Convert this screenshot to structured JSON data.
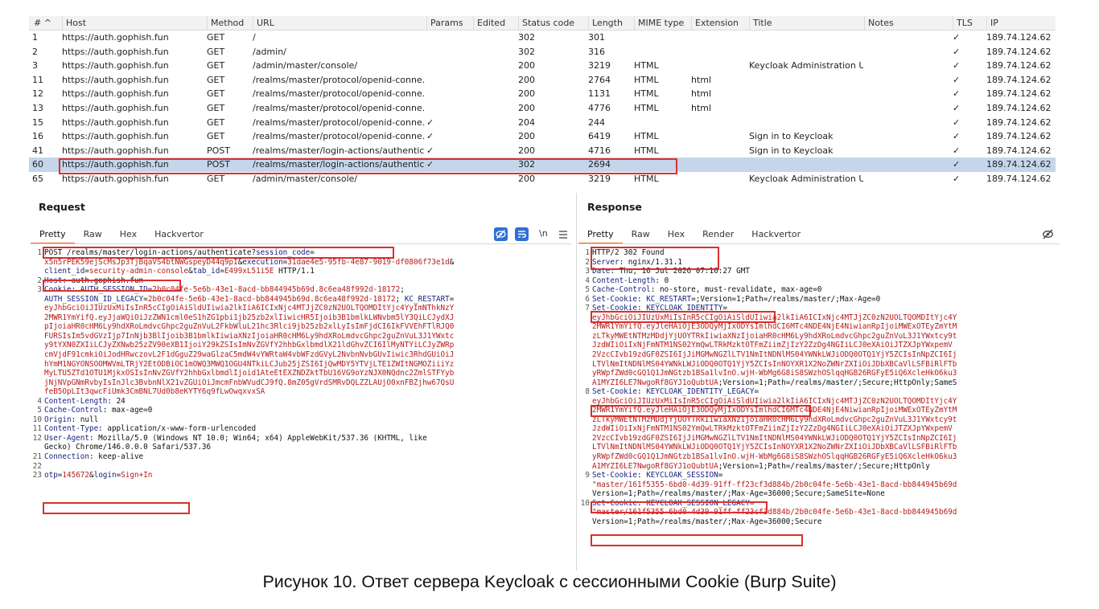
{
  "history": {
    "columns": [
      "# ^",
      "Host",
      "Method",
      "URL",
      "Params",
      "Edited",
      "Status code",
      "Length",
      "MIME type",
      "Extension",
      "Title",
      "Notes",
      "TLS",
      "IP"
    ],
    "rows": [
      {
        "num": "1",
        "host": "https://auth.gophish.fun",
        "method": "GET",
        "url": "/",
        "params": "",
        "status": "302",
        "length": "301",
        "mime": "",
        "ext": "",
        "title": "",
        "tls": "✓",
        "ip": "189.74.124.62"
      },
      {
        "num": "2",
        "host": "https://auth.gophish.fun",
        "method": "GET",
        "url": "/admin/",
        "params": "",
        "status": "302",
        "length": "316",
        "mime": "",
        "ext": "",
        "title": "",
        "tls": "✓",
        "ip": "189.74.124.62"
      },
      {
        "num": "3",
        "host": "https://auth.gophish.fun",
        "method": "GET",
        "url": "/admin/master/console/",
        "params": "",
        "status": "200",
        "length": "3219",
        "mime": "HTML",
        "ext": "",
        "title": "Keycloak Administration UI",
        "tls": "✓",
        "ip": "189.74.124.62"
      },
      {
        "num": "11",
        "host": "https://auth.gophish.fun",
        "method": "GET",
        "url": "/realms/master/protocol/openid-conne...",
        "params": "",
        "status": "200",
        "length": "2764",
        "mime": "HTML",
        "ext": "html",
        "title": "",
        "tls": "✓",
        "ip": "189.74.124.62"
      },
      {
        "num": "12",
        "host": "https://auth.gophish.fun",
        "method": "GET",
        "url": "/realms/master/protocol/openid-conne...",
        "params": "",
        "status": "200",
        "length": "1131",
        "mime": "HTML",
        "ext": "html",
        "title": "",
        "tls": "✓",
        "ip": "189.74.124.62"
      },
      {
        "num": "13",
        "host": "https://auth.gophish.fun",
        "method": "GET",
        "url": "/realms/master/protocol/openid-conne...",
        "params": "",
        "status": "200",
        "length": "4776",
        "mime": "HTML",
        "ext": "html",
        "title": "",
        "tls": "✓",
        "ip": "189.74.124.62"
      },
      {
        "num": "15",
        "host": "https://auth.gophish.fun",
        "method": "GET",
        "url": "/realms/master/protocol/openid-conne...",
        "params": "✓",
        "status": "204",
        "length": "244",
        "mime": "",
        "ext": "",
        "title": "",
        "tls": "✓",
        "ip": "189.74.124.62"
      },
      {
        "num": "16",
        "host": "https://auth.gophish.fun",
        "method": "GET",
        "url": "/realms/master/protocol/openid-conne...",
        "params": "✓",
        "status": "200",
        "length": "6419",
        "mime": "HTML",
        "ext": "",
        "title": "Sign in to Keycloak",
        "tls": "✓",
        "ip": "189.74.124.62"
      },
      {
        "num": "41",
        "host": "https://auth.gophish.fun",
        "method": "POST",
        "url": "/realms/master/login-actions/authentic...",
        "params": "✓",
        "status": "200",
        "length": "4716",
        "mime": "HTML",
        "ext": "",
        "title": "Sign in to Keycloak",
        "tls": "✓",
        "ip": "189.74.124.62"
      },
      {
        "num": "60",
        "host": "https://auth.gophish.fun",
        "method": "POST",
        "url": "/realms/master/login-actions/authentic...",
        "params": "✓",
        "status": "302",
        "length": "2694",
        "mime": "",
        "ext": "",
        "title": "",
        "tls": "✓",
        "ip": "189.74.124.62"
      },
      {
        "num": "65",
        "host": "https://auth.gophish.fun",
        "method": "GET",
        "url": "/admin/master/console/",
        "params": "",
        "status": "200",
        "length": "3219",
        "mime": "HTML",
        "ext": "",
        "title": "Keycloak Administration UI",
        "tls": "✓",
        "ip": "189.74.124.62"
      }
    ]
  },
  "request": {
    "title": "Request",
    "tabs": [
      "Pretty",
      "Raw",
      "Hex",
      "Hackvertor"
    ],
    "newline_toggle": "\\n",
    "lines": [
      {
        "n": "1",
        "segs": [
          [
            "POST /realms/master/login-actions/authenticate?",
            "t"
          ],
          [
            "session_code",
            "k"
          ],
          [
            "=",
            "t"
          ]
        ]
      },
      {
        "n": "",
        "segs": [
          [
            "x5n5rPEK59ejScMsJp3TjBqaVS4btNWGspeyD44q9pI",
            "v"
          ],
          [
            "&",
            "t"
          ],
          [
            "execution",
            "k"
          ],
          [
            "=",
            "t"
          ],
          [
            "31dae4e5-95fb-4e87-9019-df0806f73e1d",
            "v"
          ],
          [
            "&",
            "t"
          ]
        ]
      },
      {
        "n": "",
        "segs": [
          [
            "client_id",
            "k"
          ],
          [
            "=",
            "t"
          ],
          [
            "security-admin-console",
            "v"
          ],
          [
            "&",
            "t"
          ],
          [
            "tab_id",
            "k"
          ],
          [
            "=",
            "t"
          ],
          [
            "E499xL51i5E",
            "v"
          ],
          [
            " HTTP/1.1",
            "t"
          ]
        ]
      },
      {
        "n": "2",
        "segs": [
          [
            "Host",
            "k"
          ],
          [
            ": auth.gophish.fun",
            "t"
          ]
        ]
      },
      {
        "n": "3",
        "segs": [
          [
            "Cookie",
            "k"
          ],
          [
            ": ",
            "t"
          ],
          [
            "AUTH_SESSION_ID",
            "k"
          ],
          [
            "=",
            "t"
          ],
          [
            "2b0c04fe-5e6b-43e1-8acd-bb844945b69d.8c6ea48f992d-18172",
            "v"
          ],
          [
            ";",
            "t"
          ]
        ]
      },
      {
        "n": "",
        "segs": [
          [
            "AUTH_SESSION_ID_LEGACY",
            "k"
          ],
          [
            "=",
            "t"
          ],
          [
            "2b0c04fe-5e6b-43e1-8acd-bb844945b69d.8c6ea48f992d-18172",
            "v"
          ],
          [
            "; ",
            "t"
          ],
          [
            "KC_RESTART",
            "k"
          ],
          [
            "=",
            "t"
          ]
        ]
      },
      {
        "n": "",
        "segs": [
          [
            "eyJhbGciOiJIUzUxMiIsInR5cCIgOiAiSldUIiwia2lkIiA6ICIxNjc4MTJjZC0zN2UOLTQOMDItYjc4YyImNThkNzY",
            "v"
          ]
        ]
      },
      {
        "n": "",
        "segs": [
          [
            "2MWR1YmYifQ.eyJjaWQiOiJzZWN1cml0eS1hZG1pbi1jb25zb2xlIiwicHR5Ijoib3B1bmlkLWNvbm5lY3QiLCJydXJ",
            "v"
          ]
        ]
      },
      {
        "n": "",
        "segs": [
          [
            "pIjoiaHR0cHM6Ly9hdXRoLmdvcGhpc2guZnVuL2FkbWluL21hc3Rlci9jb25zb2xlLyIsImFjdCI6IkFVVEhFTlRJQ0",
            "v"
          ]
        ]
      },
      {
        "n": "",
        "segs": [
          [
            "FURSIsIm5vdGVzIjp7InNjb3BlIjoib3B1bmlkIiwiaXNzIjoiaHR0cHM6Ly9hdXRoLmdvcGhpc2guZnVuL3J1YWxtc",
            "v"
          ]
        ]
      },
      {
        "n": "",
        "segs": [
          [
            "y9tYXN0ZXIiLCJyZXNwb25zZV90eXB1IjoiY29kZSIsImNvZGVfY2hhbGxlbmdlX21ldGhvZCI6IlMyNTYiLCJyZWRp",
            "v"
          ]
        ]
      },
      {
        "n": "",
        "segs": [
          [
            "cmVjdF91cmkiOiJodHRwczovL2F1dGguZ29waGlzaC5mdW4vYWRtaW4vbWFzdGVyL2NvbnNvbGUvIiwic3RhdGUiOiJ",
            "v"
          ]
        ]
      },
      {
        "n": "",
        "segs": [
          [
            "hYmM1NGYONSOOMWVmLTRjY2EtODBiOC1mOWQ3MWQ1OGU4NTkiLCJub25jZSI6IjQwMDY5YTVjLTE1ZWItNGMOZiiiYz",
            "v"
          ]
        ]
      },
      {
        "n": "",
        "segs": [
          [
            "MyLTU5ZTd1OTU1MjkxOSIsInNvZGVfY2hhbGxlbmdlIjoid1AteEtEXZNDZktTbU16VG9oYzNJX0NQdnc2ZmlSTFYyb",
            "v"
          ]
        ]
      },
      {
        "n": "",
        "segs": [
          [
            "jNjNVpGNmRvbyIsInJlc3BvbnNlX21vZGUiOiJmcmFnbWVudCJ9fQ.8mZ05gVrdSMRvDQLZZLAUjO0xnFBZjhw67QsU",
            "v"
          ]
        ]
      },
      {
        "n": "",
        "segs": [
          [
            "feB5OpLIt3qwcFiUmk3CmBNL7Ud0b8eKYTY6q9fLwOwqxvxSA",
            "v"
          ]
        ]
      },
      {
        "n": "4",
        "segs": [
          [
            "Content-Length",
            "k"
          ],
          [
            ": 24",
            "t"
          ]
        ]
      },
      {
        "n": "5",
        "segs": [
          [
            "Cache-Control",
            "k"
          ],
          [
            ": max-age=0",
            "t"
          ]
        ]
      },
      {
        "n": "10",
        "segs": [
          [
            "Origin",
            "k"
          ],
          [
            ": null",
            "t"
          ]
        ]
      },
      {
        "n": "11",
        "segs": [
          [
            "Content-Type",
            "k"
          ],
          [
            ": application/x-www-form-urlencoded",
            "t"
          ]
        ]
      },
      {
        "n": "12",
        "segs": [
          [
            "User-Agent",
            "k"
          ],
          [
            ": Mozilla/5.0 (Windows NT 10.0; Win64; x64) AppleWebKit/537.36 (KHTML, like",
            "t"
          ]
        ]
      },
      {
        "n": "",
        "segs": [
          [
            "Gecko) Chrome/146.0.0.0 Safari/537.36",
            "t"
          ]
        ]
      },
      {
        "n": "21",
        "segs": [
          [
            "Connection",
            "k"
          ],
          [
            ": keep-alive",
            "t"
          ]
        ]
      },
      {
        "n": "22",
        "segs": []
      },
      {
        "n": "23",
        "segs": [
          [
            "otp",
            "k"
          ],
          [
            "=",
            "t"
          ],
          [
            "145672",
            "v"
          ],
          [
            "&",
            "t"
          ],
          [
            "login",
            "k"
          ],
          [
            "=",
            "t"
          ],
          [
            "Sign+In",
            "v"
          ]
        ]
      }
    ]
  },
  "response": {
    "title": "Response",
    "tabs": [
      "Pretty",
      "Raw",
      "Hex",
      "Render",
      "Hackvertor"
    ],
    "lines": [
      {
        "n": "1",
        "segs": [
          [
            "HTTP/2 302 Found",
            "t"
          ]
        ]
      },
      {
        "n": "2",
        "segs": [
          [
            "Server",
            "k"
          ],
          [
            ": nginx/1.31.1",
            "t"
          ]
        ]
      },
      {
        "n": "3",
        "segs": [
          [
            "Date",
            "k"
          ],
          [
            ": Thu, 16 Jul 2026 07:16:27 GMT",
            "t"
          ]
        ]
      },
      {
        "n": "4",
        "segs": [
          [
            "Content-Length",
            "k"
          ],
          [
            ": 0",
            "t"
          ]
        ]
      },
      {
        "n": "5",
        "segs": [
          [
            "Cache-Control",
            "k"
          ],
          [
            ": no-store, must-revalidate, max-age=0",
            "t"
          ]
        ]
      },
      {
        "n": "6",
        "segs": [
          [
            "Set-Cookie",
            "k"
          ],
          [
            ": ",
            "t"
          ],
          [
            "KC_RESTART",
            "k"
          ],
          [
            "=;Version=1;Path=/realms/master/;Max-Age=0",
            "t"
          ]
        ]
      },
      {
        "n": "7",
        "segs": [
          [
            "Set-Cookie",
            "k"
          ],
          [
            ": ",
            "t"
          ],
          [
            "KEYCLOAK_IDENTITY",
            "k"
          ],
          [
            "=",
            "t"
          ]
        ]
      },
      {
        "n": "",
        "segs": [
          [
            "eyJhbGciOiJIUzUxMiIsInR5cCIgOiAiSldUIiwia2lkIiA6ICIxNjc4MTJjZC0zN2UOLTQOMDItYjc4Y",
            "v"
          ]
        ]
      },
      {
        "n": "",
        "segs": [
          [
            "2MWR1YmYifQ.eyJleHAiOjE3ODQyMjIxODYsImlhdCI6MTc4NDE4NjE4NiwianRpIjoiMWExOTEyZmYtM",
            "v"
          ]
        ]
      },
      {
        "n": "",
        "segs": [
          [
            "zLTkyMWEtNTMzMDdjYjUOYTRkIiwiaXNzIjoiaHR0cHM6Ly9hdXRoLmdvcGhpc2guZnVuL3J1YWxtcy9t",
            "v"
          ]
        ]
      },
      {
        "n": "",
        "segs": [
          [
            "JzdWIiOiIxNjFmNTM1NS02YmQwLTRkMzktOTFmZiimZjIzY2ZzDg4NGIiLCJ0eXAiOiJTZXJpYWxpemV",
            "v"
          ]
        ]
      },
      {
        "n": "",
        "segs": [
          [
            "2VzcCIvb19zdGF0ZSI6IjJiMGMwNGZlLTV1NmItNDNlMS04YWNkLWJiODQ0OTQ1YjY5ZCIsInNpZCI6Ij",
            "v"
          ]
        ]
      },
      {
        "n": "",
        "segs": [
          [
            "LTVlNmItNDNlMS04YWNkLWJiODQ0OTQ1YjY5ZCIsInNOYXR1X2NoZWNrZXIiOiJDbXBCaVlLSFBiRlFTb",
            "v"
          ]
        ]
      },
      {
        "n": "",
        "segs": [
          [
            "yRWpfZWd0cGQ1Q1JmNGtzb1BSa1lvInO.wjH-WbMg6G8iS8SWzhOSlqqHGB26RGFyE5iQ6XcleHkO6ku3",
            "v"
          ]
        ]
      },
      {
        "n": "",
        "segs": [
          [
            "A1MYZI6LE7NwgoRf8GYJ1oQubtUA",
            "v"
          ],
          [
            ";Version=1;Path=/realms/master/;Secure;HttpOnly;SameS",
            "t"
          ]
        ]
      },
      {
        "n": "8",
        "segs": [
          [
            "Set-Cookie",
            "k"
          ],
          [
            ": ",
            "t"
          ],
          [
            "KEYCLOAK_IDENTITY_LEGACY",
            "k"
          ],
          [
            "=",
            "t"
          ]
        ]
      },
      {
        "n": "",
        "segs": [
          [
            "eyJhbGciOiJIUzUxMiIsInR5cCIgOiAiSldUIiwia2lkIiA6ICIxNjc4MTJjZC0zN2UOLTQOMDItYjc4Y",
            "v"
          ]
        ]
      },
      {
        "n": "",
        "segs": [
          [
            "2MWR1YmYifQ.eyJleHAiOjE3ODQyMjIxODYsImlhdCI6MTc4NDE4NjE4NiwianRpIjoiMWExOTEyZmYtM",
            "v"
          ]
        ]
      },
      {
        "n": "",
        "segs": [
          [
            "zLTkyMWEtNTMzMDdjYjUOYTRkIiwiaXNzIjoiaHR0cHM6Ly9hdXRoLmdvcGhpc2guZnVuL3J1YWxtcy9t",
            "v"
          ]
        ]
      },
      {
        "n": "",
        "segs": [
          [
            "JzdWIiOiIxNjFmNTM1NS02YmQwLTRkMzktOTFmZiimZjIzY2ZzDg4NGIiLCJ0eXAiOiJTZXJpYWxpemV",
            "v"
          ]
        ]
      },
      {
        "n": "",
        "segs": [
          [
            "2VzcCIvb19zdGF0ZSI6IjJiMGMwNGZlLTV1NmItNDNlMS04YWNkLWJiODQ0OTQ1YjY5ZCIsInNpZCI6Ij",
            "v"
          ]
        ]
      },
      {
        "n": "",
        "segs": [
          [
            "LTVlNmItNDNlMS04YWNkLWJiODQ0OTQ1YjY5ZCIsInNOYXR1X2NoZWNrZXIiOiJDbXBCaVlLSFBiRlFTb",
            "v"
          ]
        ]
      },
      {
        "n": "",
        "segs": [
          [
            "yRWpfZWd0cGQ1Q1JmNGtzb1BSa1lvInO.wjH-WbMg6G8iS8SWzhOSlqqHGB26RGFyE5iQ6XcleHkO6ku3",
            "v"
          ]
        ]
      },
      {
        "n": "",
        "segs": [
          [
            "A1MYZI6LE7NwgoRf8GYJ1oQubtUA",
            "v"
          ],
          [
            ";Version=1;Path=/realms/master/;Secure;HttpOnly",
            "t"
          ]
        ]
      },
      {
        "n": "9",
        "segs": [
          [
            "Set-Cookie",
            "k"
          ],
          [
            ": ",
            "t"
          ],
          [
            "KEYCLOAK_SESSION",
            "k"
          ],
          [
            "=",
            "t"
          ]
        ]
      },
      {
        "n": "",
        "segs": [
          [
            "\"master/161f5355-6bd0-4d39-91ff-ff23cf3d884b/2b0c04fe-5e6b-43e1-8acd-bb844945b69d",
            "v"
          ]
        ]
      },
      {
        "n": "",
        "segs": [
          [
            "Version=1;Path=/realms/master/;Max-Age=36000;Secure;SameSite=None",
            "t"
          ]
        ]
      },
      {
        "n": "10",
        "segs": [
          [
            "Set-Cookie",
            "k"
          ],
          [
            ": ",
            "t"
          ],
          [
            "KEYCLOAK_SESSION_LEGACY",
            "k"
          ],
          [
            "=",
            "t"
          ]
        ]
      },
      {
        "n": "",
        "segs": [
          [
            "\"master/161f5355-6bd0-4d39-91ff-ff23cf3d884b/2b0c04fe-5e6b-43e1-8acd-bb844945b69d",
            "v"
          ]
        ]
      },
      {
        "n": "",
        "segs": [
          [
            "Version=1;Path=/realms/master/;Max-Age=36000;Secure",
            "t"
          ]
        ]
      }
    ]
  },
  "caption": "Рисунок 10. Ответ сервера Keycloak с сессионными Cookie (Burp Suite)",
  "colors": {
    "highlight_box": "#d9302c",
    "selected_row": "#c5d6ec",
    "active_tab": "#e8681c",
    "key_text": "#1a237e",
    "value_text": "#b71c1c",
    "toolbar_icon": "#2f6fd6"
  },
  "icons": [
    "eye-off-icon",
    "word-wrap-icon",
    "newline-toggle",
    "menu-icon"
  ]
}
